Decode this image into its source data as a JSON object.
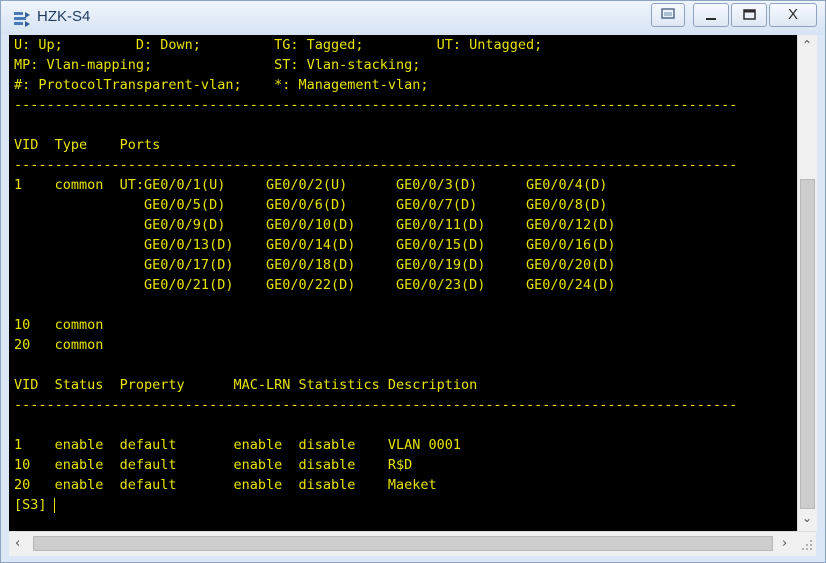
{
  "window": {
    "title": "HZK-S4"
  },
  "console": {
    "lines": [
      "U: Up;         D: Down;         TG: Tagged;         UT: Untagged;",
      "MP: Vlan-mapping;               ST: Vlan-stacking;",
      "#: ProtocolTransparent-vlan;    *: Management-vlan;",
      "-----------------------------------------------------------------------------------------",
      "",
      "VID  Type    Ports",
      "-----------------------------------------------------------------------------------------",
      "1    common  UT:GE0/0/1(U)     GE0/0/2(U)      GE0/0/3(D)      GE0/0/4(D)",
      "                GE0/0/5(D)     GE0/0/6(D)      GE0/0/7(D)      GE0/0/8(D)",
      "                GE0/0/9(D)     GE0/0/10(D)     GE0/0/11(D)     GE0/0/12(D)",
      "                GE0/0/13(D)    GE0/0/14(D)     GE0/0/15(D)     GE0/0/16(D)",
      "                GE0/0/17(D)    GE0/0/18(D)     GE0/0/19(D)     GE0/0/20(D)",
      "                GE0/0/21(D)    GE0/0/22(D)     GE0/0/23(D)     GE0/0/24(D)",
      "",
      "10   common",
      "20   common",
      "",
      "VID  Status  Property      MAC-LRN Statistics Description",
      "-----------------------------------------------------------------------------------------",
      "",
      "1    enable  default       enable  disable    VLAN 0001",
      "10   enable  default       enable  disable    R$D",
      "20   enable  default       enable  disable    Maeket",
      "[S3]"
    ]
  },
  "colors": {
    "console_bg": "#000000",
    "console_text": "#e8e400",
    "titlebar_text": "#1e3b5f"
  },
  "icons": {
    "app": "network-switch-icon",
    "restore": "restore-icon",
    "minimize": "minimize-icon",
    "maximize": "maximize-icon",
    "close": "close-icon"
  },
  "buttons": {
    "close_label": "X"
  }
}
